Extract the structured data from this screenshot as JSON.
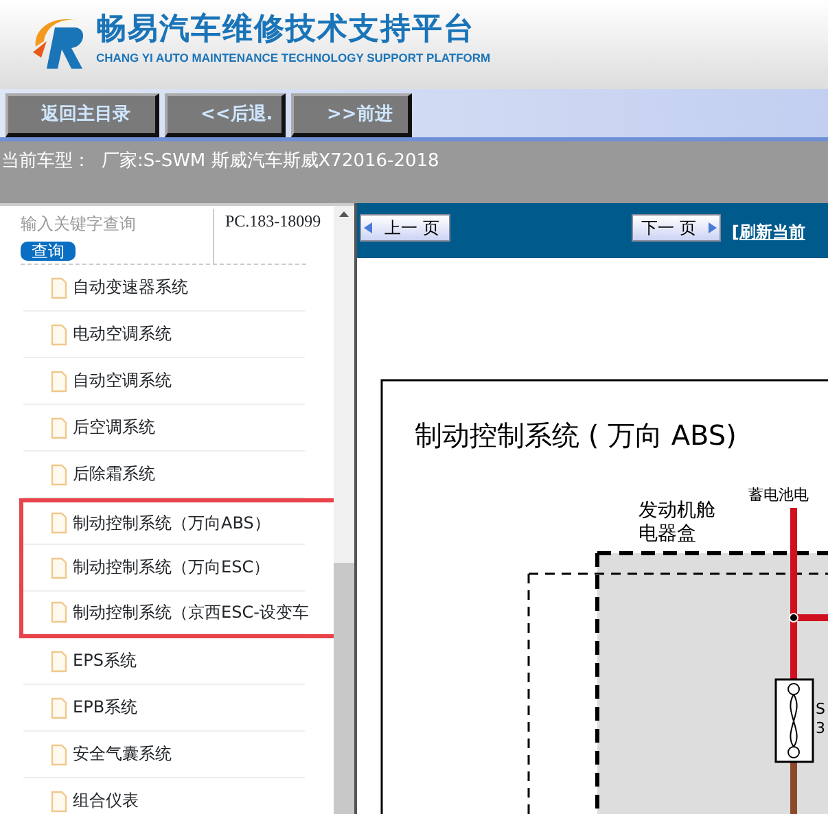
{
  "header": {
    "title": "畅易汽车维修技术支持平台",
    "subtitle": "CHANG YI AUTO MAINTENANCE TECHNOLOGY SUPPORT PLATFORM"
  },
  "nav_buttons": [
    "返回主目录",
    "<<后退.",
    ">>前进"
  ],
  "vehicle": {
    "label": "当前车型：",
    "value": "厂家:S-SWM 斯威汽车斯威X72016-2018"
  },
  "sidebar": {
    "search": {
      "placeholder": "输入关键字查询"
    },
    "search_button": "查询",
    "code": "PC.183-18099",
    "items": [
      {
        "label": "自动变速器系统",
        "highlighted": false
      },
      {
        "label": "电动空调系统",
        "highlighted": false
      },
      {
        "label": "自动空调系统",
        "highlighted": false
      },
      {
        "label": "后空调系统",
        "highlighted": false
      },
      {
        "label": "后除霜系统",
        "highlighted": false
      },
      {
        "label": "制动控制系统（万向ABS）",
        "highlighted": true
      },
      {
        "label": "制动控制系统（万向ESC）",
        "highlighted": true
      },
      {
        "label": "制动控制系统（京西ESC-设变车",
        "highlighted": true
      },
      {
        "label": "EPS系统",
        "highlighted": false
      },
      {
        "label": "EPB系统",
        "highlighted": false
      },
      {
        "label": "安全气囊系统",
        "highlighted": false
      },
      {
        "label": "组合仪表",
        "highlighted": false
      }
    ]
  },
  "viewer": {
    "prev_button": "上一 页",
    "next_button": "下一 页",
    "refresh_link": "[刷新当前",
    "diagram": {
      "title": "制动控制系统 ( 万向 ABS)",
      "battery_label": "蓄电池电",
      "box_label": [
        "发动机舱",
        "电器盒"
      ],
      "fuse_label": [
        "S",
        "3"
      ]
    }
  }
}
